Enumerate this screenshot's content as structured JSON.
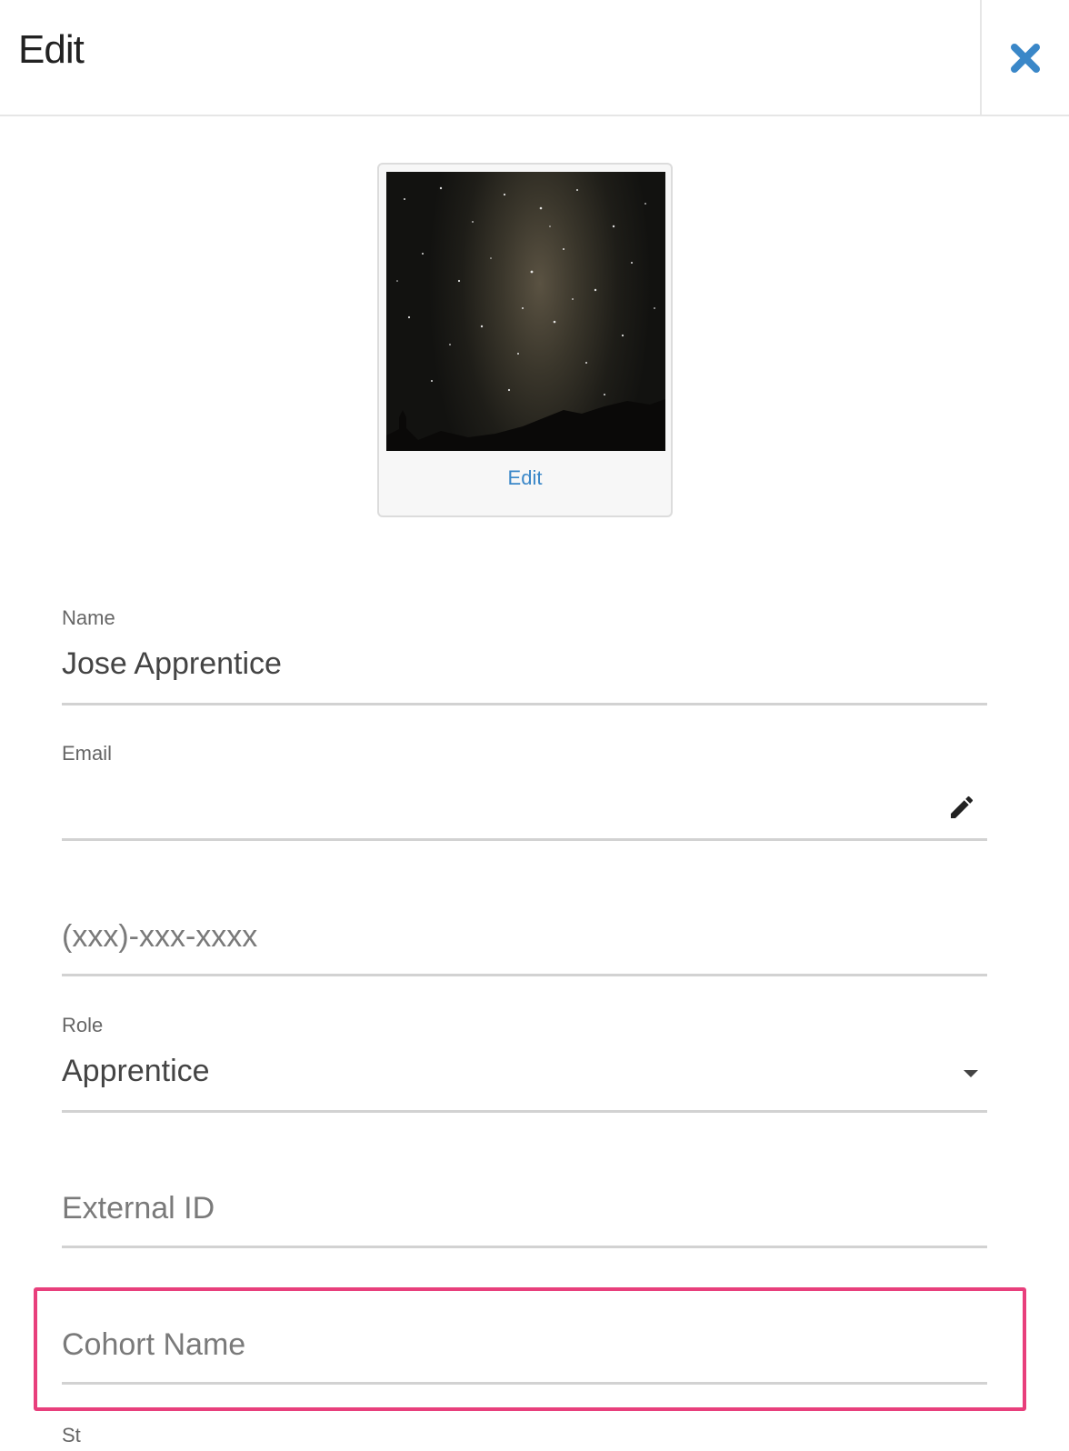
{
  "header": {
    "title": "Edit",
    "close_icon": "close-x-icon",
    "accent_color": "#3a87c8"
  },
  "photo": {
    "edit_label": "Edit",
    "description_icon": "starry-sky-photo"
  },
  "form": {
    "name": {
      "label": "Name",
      "value": "Jose Apprentice"
    },
    "email": {
      "label": "Email",
      "value": "",
      "edit_icon": "pencil-icon"
    },
    "phone": {
      "placeholder": "(xxx)-xxx-xxxx"
    },
    "role": {
      "label": "Role",
      "value": "Apprentice",
      "dropdown_icon": "caret-down-icon"
    },
    "external_id": {
      "placeholder": "External ID"
    },
    "cohort_name": {
      "placeholder": "Cohort Name"
    },
    "next_label_partial": "St"
  },
  "highlight_color": "#e83f7c"
}
